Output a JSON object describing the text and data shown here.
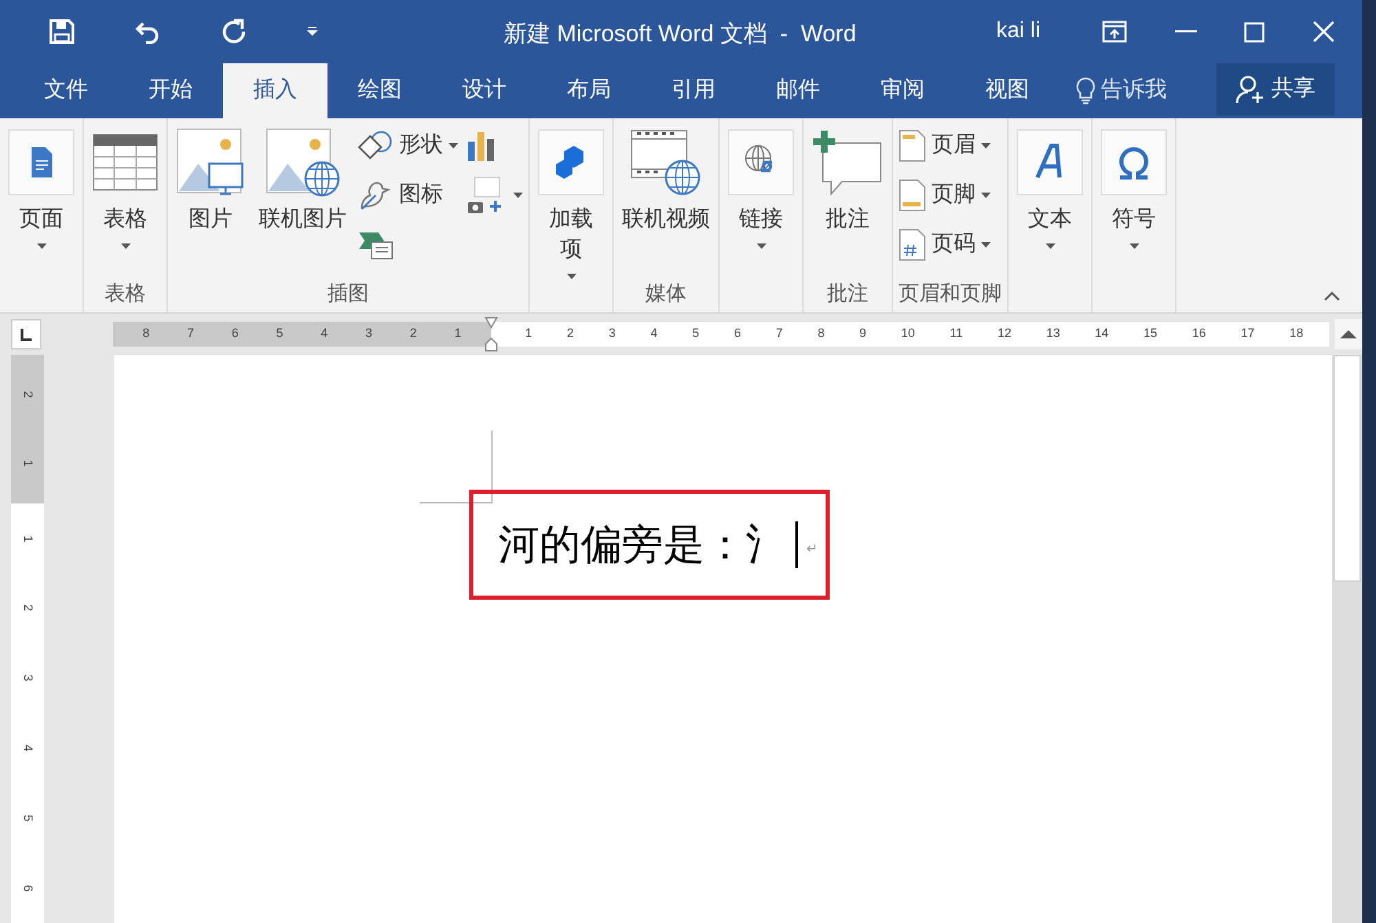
{
  "window": {
    "title": "新建 Microsoft Word 文档  -  Word",
    "user": "kai li"
  },
  "tabs": [
    {
      "label": "文件",
      "selected": false
    },
    {
      "label": "开始",
      "selected": false
    },
    {
      "label": "插入",
      "selected": true
    },
    {
      "label": "绘图",
      "selected": false
    },
    {
      "label": "设计",
      "selected": false
    },
    {
      "label": "布局",
      "selected": false
    },
    {
      "label": "引用",
      "selected": false
    },
    {
      "label": "邮件",
      "selected": false
    },
    {
      "label": "审阅",
      "selected": false
    },
    {
      "label": "视图",
      "selected": false
    }
  ],
  "tell_me": "告诉我",
  "share": "共享",
  "ribbon": {
    "groups": [
      {
        "items": [
          {
            "kind": "large",
            "label": "页面",
            "dropdown": true
          }
        ]
      },
      {
        "label": "表格",
        "items": [
          {
            "kind": "large",
            "label": "表格",
            "dropdown": true
          }
        ]
      },
      {
        "label": "插图",
        "items": [
          {
            "kind": "large",
            "label": "图片",
            "dropdown": false
          },
          {
            "kind": "large",
            "label": "联机图片",
            "dropdown": false
          },
          {
            "kind": "stack",
            "items": [
              {
                "label": "形状",
                "dropdown": true
              },
              {
                "label": "图标",
                "dropdown": false
              },
              {
                "dropdown": false
              }
            ]
          },
          {
            "kind": "stack",
            "items": [
              {
                "dropdown": false
              },
              {
                "dropdown": true
              }
            ]
          }
        ]
      },
      {
        "items": [
          {
            "kind": "large",
            "label": "加载项",
            "dropdown": true
          }
        ]
      },
      {
        "label": "媒体",
        "items": [
          {
            "kind": "large",
            "label": "联机视频",
            "dropdown": false
          }
        ]
      },
      {
        "items": [
          {
            "kind": "large",
            "label": "链接",
            "dropdown": true
          }
        ]
      },
      {
        "label": "批注",
        "items": [
          {
            "kind": "large",
            "label": "批注",
            "dropdown": false
          }
        ]
      },
      {
        "label": "页眉和页脚",
        "items": [
          {
            "kind": "stack",
            "items": [
              {
                "label": "页眉",
                "dropdown": true
              },
              {
                "label": "页脚",
                "dropdown": true
              },
              {
                "label": "页码",
                "dropdown": true
              }
            ]
          }
        ]
      },
      {
        "items": [
          {
            "kind": "large",
            "label": "文本",
            "dropdown": true
          }
        ]
      },
      {
        "items": [
          {
            "kind": "large",
            "label": "符号",
            "dropdown": true
          }
        ]
      }
    ]
  },
  "ruler": {
    "left_numbers": [
      "8",
      "7",
      "6",
      "5",
      "4",
      "3",
      "2",
      "1"
    ],
    "right_numbers": [
      "1",
      "2",
      "3",
      "4",
      "5",
      "6",
      "7",
      "8",
      "9",
      "10",
      "11",
      "12",
      "13",
      "14",
      "15",
      "16",
      "17",
      "18"
    ]
  },
  "vertical_ruler": {
    "top_numbers": [
      "2",
      "1"
    ],
    "numbers": [
      "1",
      "2",
      "3",
      "4",
      "5",
      "6"
    ]
  },
  "document": {
    "text": "河的偏旁是：氵",
    "paragraph_mark": "↵",
    "highlighted": true
  }
}
